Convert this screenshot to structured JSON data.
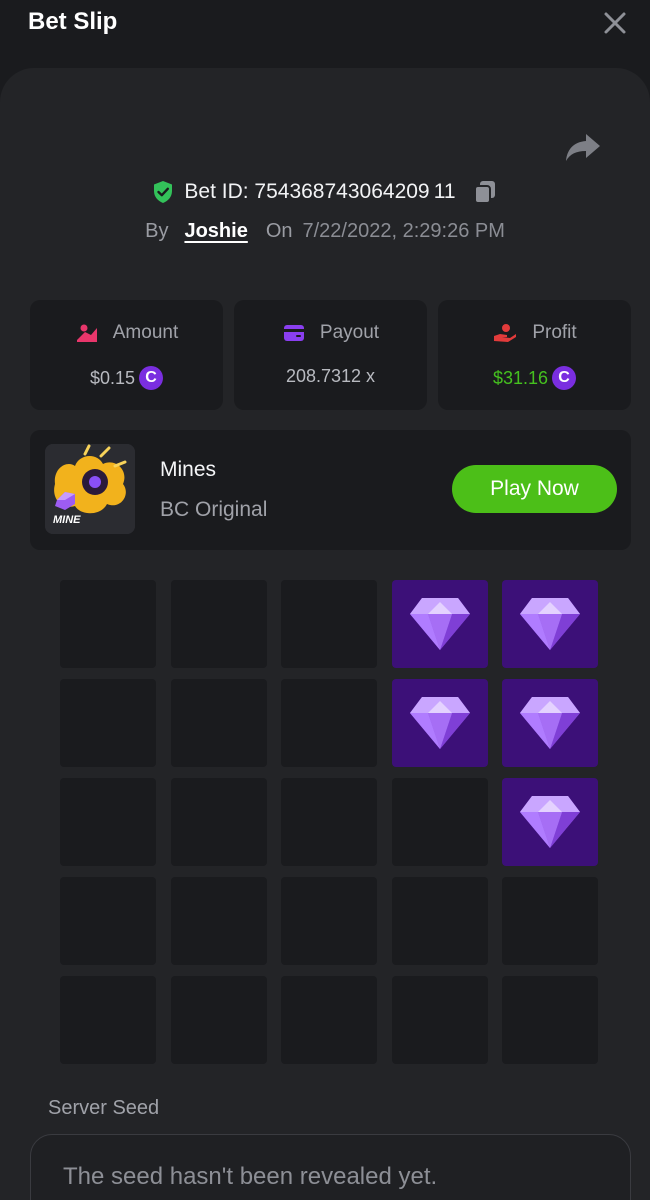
{
  "header": {
    "title": "Bet Slip"
  },
  "bet": {
    "id_label": "Bet ID: 754368743064209 11",
    "by_label": "By",
    "username": "Joshie",
    "on_label": "On",
    "date": "7/22/2022, 2:29:26 PM"
  },
  "stats": {
    "amount": {
      "label": "Amount",
      "value": "$0.15",
      "icon": "amount-icon"
    },
    "payout": {
      "label": "Payout",
      "value": "208.7312 x",
      "icon": "wallet-icon"
    },
    "profit": {
      "label": "Profit",
      "value": "$31.16",
      "icon": "profit-hand-icon"
    }
  },
  "coin_symbol": "C",
  "game": {
    "name": "Mines",
    "provider": "BC Original",
    "thumb_label": "MINE",
    "play_label": "Play Now"
  },
  "board": {
    "rows": 5,
    "cols": 5,
    "revealed_gems": [
      [
        0,
        3
      ],
      [
        0,
        4
      ],
      [
        1,
        3
      ],
      [
        1,
        4
      ],
      [
        2,
        4
      ]
    ]
  },
  "server_seed": {
    "label": "Server Seed",
    "value": "The seed hasn't been revealed yet."
  },
  "colors": {
    "accent_green": "#4cbf18",
    "profit_green": "#45c01f",
    "gem_tile": "#3c1078",
    "coin_purple": "#7a2ee0"
  }
}
